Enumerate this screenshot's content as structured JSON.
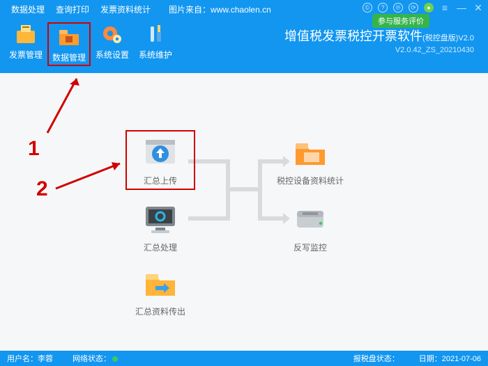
{
  "menubar": {
    "items": [
      "数据处理",
      "查询打印",
      "发票资料统计"
    ],
    "watermark": "图片来自：www.chaolen.cn"
  },
  "window_controls": {
    "badges": [
      "©",
      "?",
      "℗",
      "⟳",
      "●"
    ],
    "eval": "参与服务评价"
  },
  "toolbar": {
    "items": [
      {
        "label": "发票管理",
        "icon": "invoice-icon"
      },
      {
        "label": "数据管理",
        "icon": "folder-data-icon",
        "highlight": true
      },
      {
        "label": "系统设置",
        "icon": "gear-icon"
      },
      {
        "label": "系统维护",
        "icon": "tools-icon"
      }
    ],
    "title": {
      "main": "增值税发票税控开票软件",
      "edition": "(税控盘版)V2.0",
      "version": "V2.0.42_ZS_20210430"
    }
  },
  "nodes": {
    "upload": {
      "label": "汇总上传"
    },
    "device": {
      "label": "税控设备资料统计"
    },
    "process": {
      "label": "汇总处理"
    },
    "monitor": {
      "label": "反写监控"
    },
    "export": {
      "label": "汇总资料传出"
    }
  },
  "annotations": {
    "n1": "1",
    "n2": "2"
  },
  "status": {
    "user": "用户名：李蓉",
    "net": "网络状态：",
    "tax": "报税盘状态：",
    "date": "日期：2021-07-06"
  }
}
